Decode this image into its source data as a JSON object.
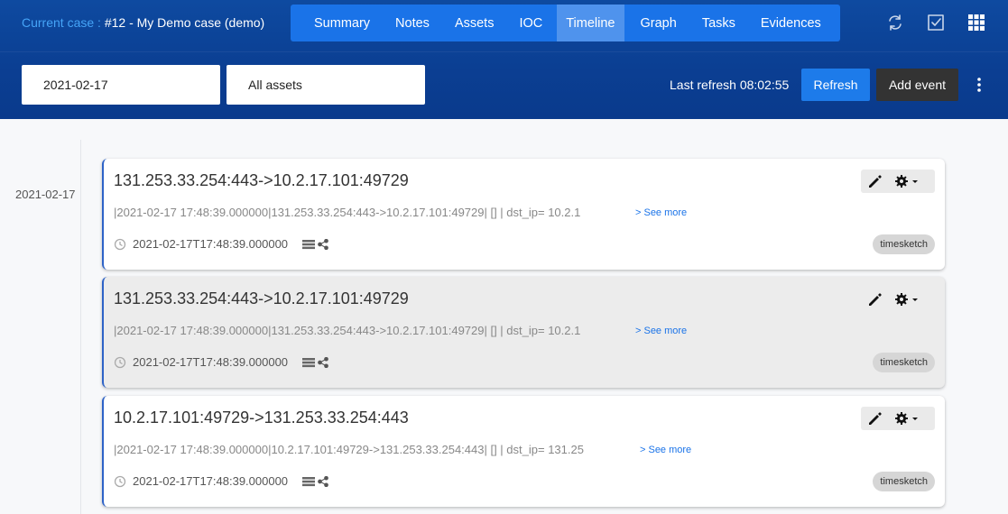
{
  "header": {
    "case_label": "Current case :",
    "case_name": "#12 - My Demo case (demo)"
  },
  "nav": {
    "items": [
      "Summary",
      "Notes",
      "Assets",
      "IOC",
      "Timeline",
      "Graph",
      "Tasks",
      "Evidences"
    ],
    "active": "Timeline"
  },
  "filters": {
    "date_value": "2021-02-17",
    "assets_value": "All assets"
  },
  "toolbar": {
    "last_refresh": "Last refresh 08:02:55",
    "refresh_label": "Refresh",
    "add_event_label": "Add event"
  },
  "timeline": {
    "date_group": "2021-02-17",
    "see_more_label": "> See more",
    "events": [
      {
        "title": "131.253.33.254:443->10.2.17.101:49729",
        "raw": "|2021-02-17 17:48:39.000000|131.253.33.254:443->10.2.17.101:49729| [] | dst_ip= 10.2.1",
        "timestamp": "2021-02-17T17:48:39.000000",
        "tag": "timesketch",
        "highlighted": false
      },
      {
        "title": "131.253.33.254:443->10.2.17.101:49729",
        "raw": "|2021-02-17 17:48:39.000000|131.253.33.254:443->10.2.17.101:49729| [] | dst_ip= 10.2.1",
        "timestamp": "2021-02-17T17:48:39.000000",
        "tag": "timesketch",
        "highlighted": true
      },
      {
        "title": "10.2.17.101:49729->131.253.33.254:443",
        "raw": "|2021-02-17 17:48:39.000000|10.2.17.101:49729->131.253.33.254:443| [] | dst_ip= 131.25",
        "timestamp": "2021-02-17T17:48:39.000000",
        "tag": "timesketch",
        "highlighted": false
      }
    ]
  },
  "icons": {
    "switch_case": "refresh-cycle-icon",
    "tasks": "checkbox-icon",
    "apps": "grid-icon",
    "menu": "kebab-menu-icon",
    "clock": "clock-icon",
    "source": "database-icon",
    "graph": "share-icon",
    "edit": "pencil-icon",
    "settings": "gear-icon"
  }
}
